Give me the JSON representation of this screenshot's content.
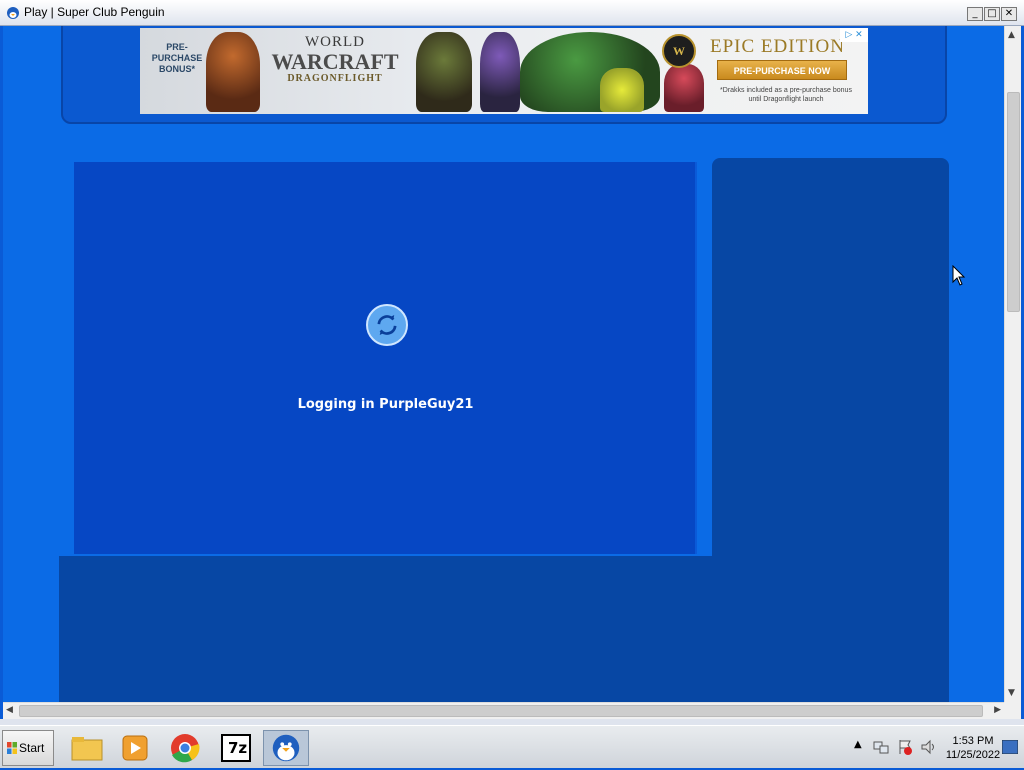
{
  "window": {
    "title": "Play | Super Club Penguin",
    "min_label": "_",
    "max_label": "□",
    "close_label": "✕"
  },
  "ad": {
    "prebonus": "PRE-\nPURCHASE\nBONUS*",
    "wow_line1": "WORLD",
    "wow_line2": "WARCRAFT",
    "wow_line3": "DRAGONFLIGHT",
    "badge": "W",
    "epic_title": "EPIC EDITION",
    "cta_label": "PRE-PURCHASE NOW",
    "fineprint": "*Drakks included as a pre-purchase bonus until Dragonflight launch",
    "choices": "▷ ✕"
  },
  "game": {
    "status_text": "Logging in PurpleGuy21"
  },
  "taskbar": {
    "start_label": "Start",
    "apps": [
      "file-explorer-icon",
      "media-player-icon",
      "chrome-icon",
      "7zip-icon",
      "club-penguin-icon"
    ],
    "zip_label": "7z",
    "clock_time": "1:53 PM",
    "clock_date": "11/25/2022"
  },
  "colors": {
    "page_bg": "#0b6be6",
    "game_main": "#0647c4",
    "game_side": "#0747a4",
    "ad_frame": "#0b59d0",
    "cta": "#d69a2c"
  }
}
